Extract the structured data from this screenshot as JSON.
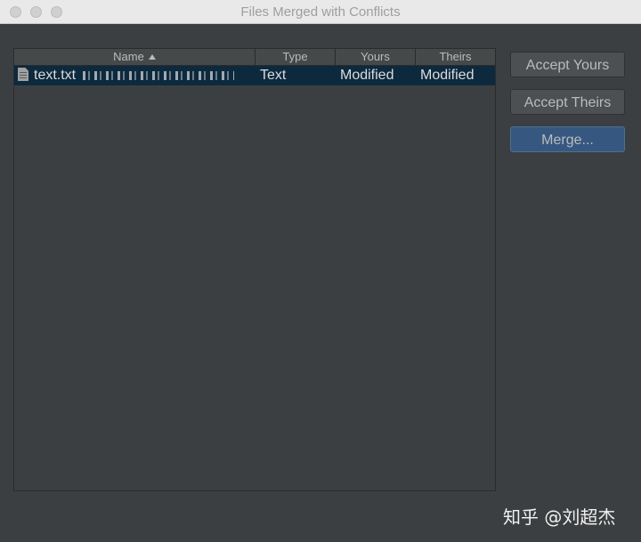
{
  "window": {
    "title": "Files Merged with Conflicts"
  },
  "table": {
    "columns": [
      "Name",
      "Type",
      "Yours",
      "Theirs"
    ],
    "sort_column": "Name",
    "sort_direction": "ascending",
    "rows": [
      {
        "icon": "text-file-icon",
        "name": "text.txt",
        "path_redacted": true,
        "type": "Text",
        "yours": "Modified",
        "theirs": "Modified",
        "selected": true
      }
    ]
  },
  "buttons": {
    "accept_yours": "Accept Yours",
    "accept_theirs": "Accept Theirs",
    "merge": "Merge..."
  },
  "watermark": {
    "text": "知乎 @刘超杰"
  },
  "colors": {
    "background": "#3c3f41",
    "selection": "#0d293e",
    "default_button": "#365880",
    "text": "#bbbbbb"
  }
}
